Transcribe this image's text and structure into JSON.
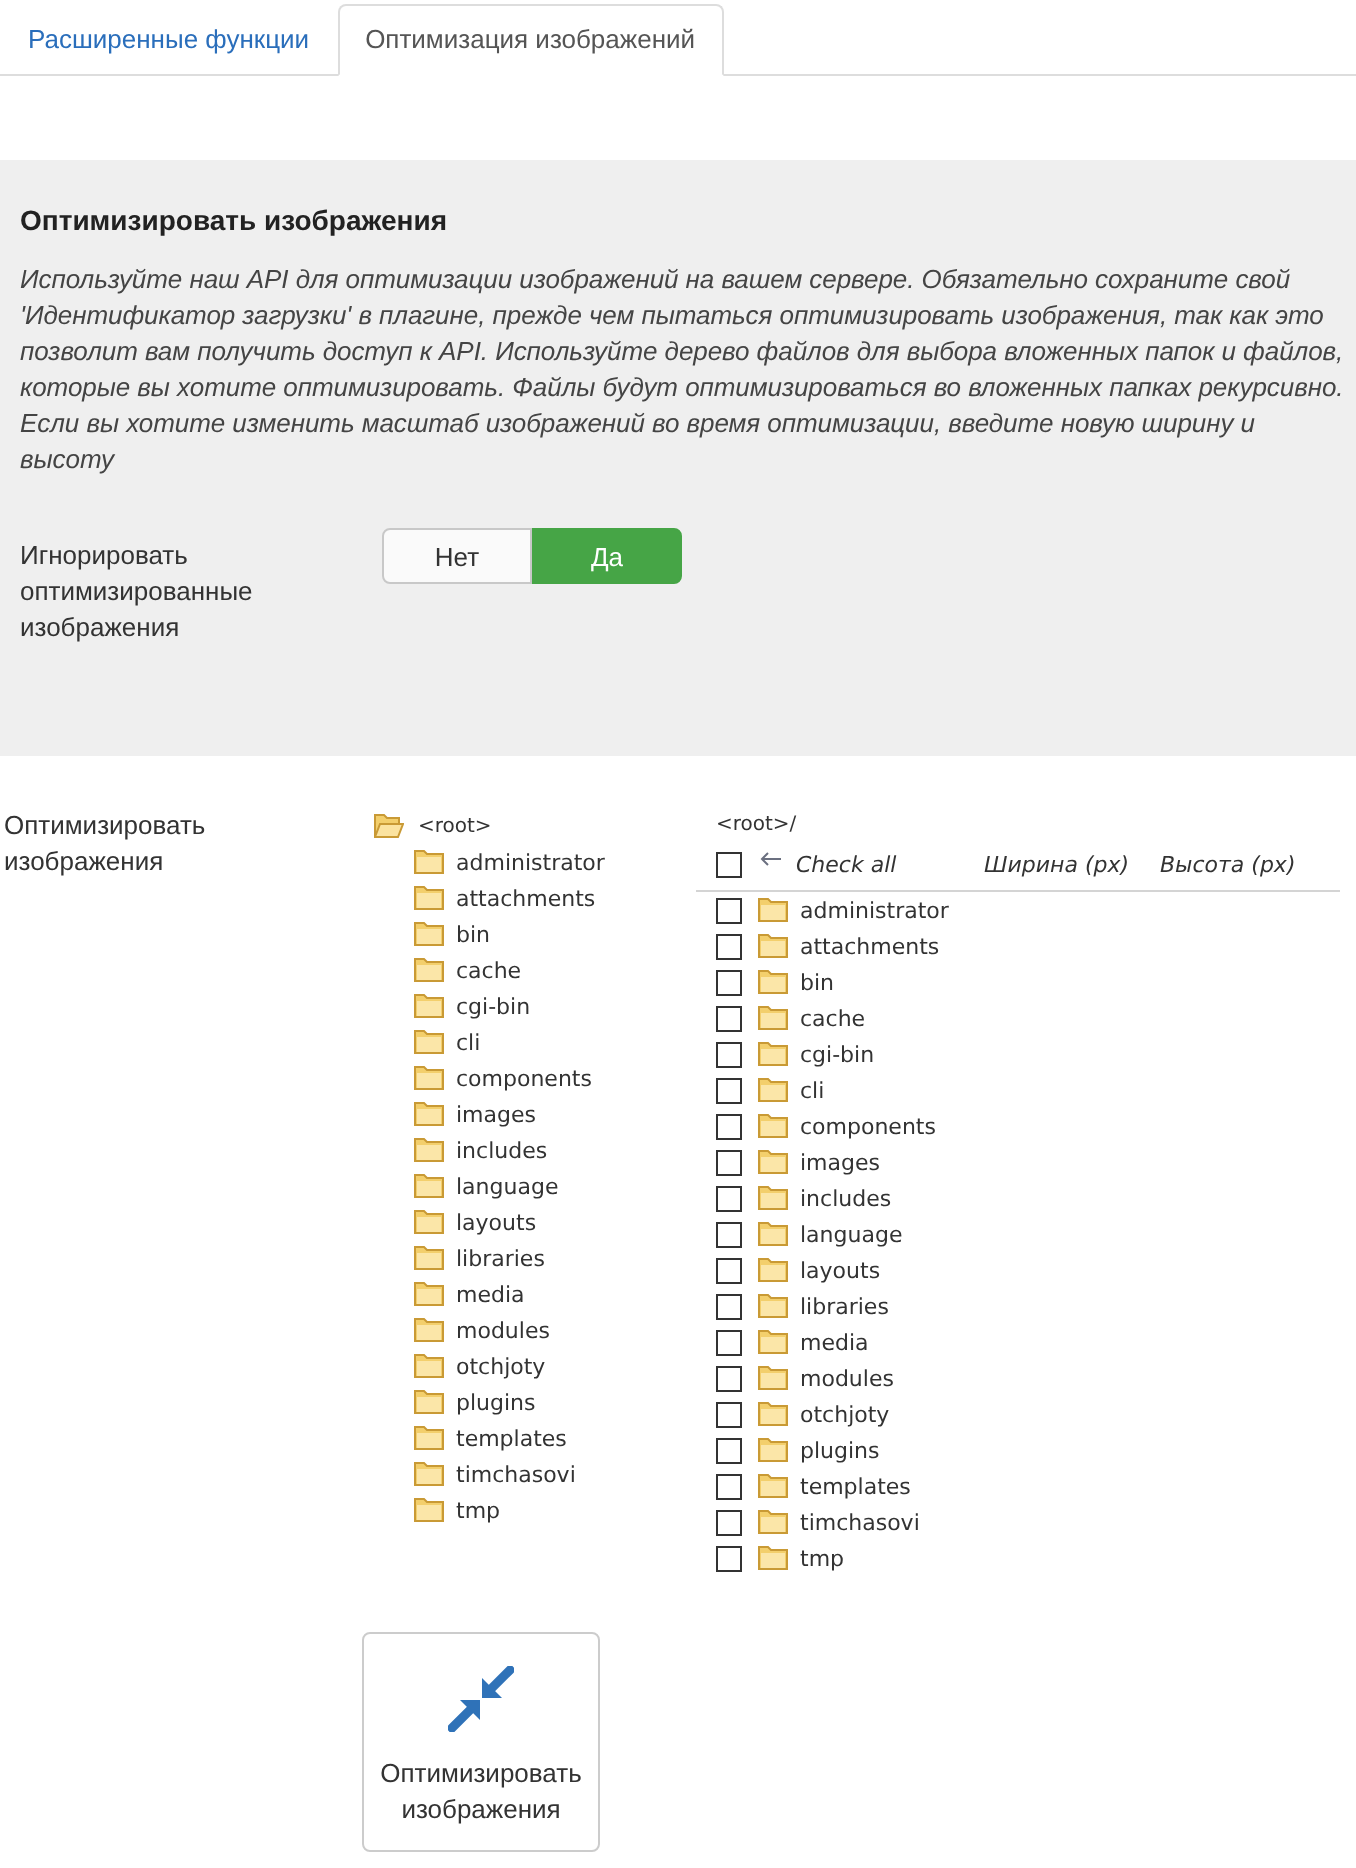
{
  "tabs": [
    {
      "label": "Расширенные функции",
      "selected": false
    },
    {
      "label": "Оптимизация изображений",
      "selected": true
    }
  ],
  "panel": {
    "title": "Оптимизировать изображения",
    "description": "Используйте наш API для оптимизации изображений на вашем сервере. Обязательно сохраните свой 'Идентификатор загрузки' в плагине, прежде чем пытаться оптимизировать изображения, так как это позволит вам получить доступ к API. Используйте дерево файлов для выбора вложенных папок и файлов, которые вы хотите оптимизировать. Файлы будут оптимизироваться во вложенных папках рекурсивно. Если вы хотите изменить масштаб изображений во время оптимизации, введите новую ширину и высоту",
    "ignore_optimized": {
      "label": "Игнорировать оптимизированные изображения",
      "options": [
        {
          "label": "Нет",
          "selected": false
        },
        {
          "label": "Да",
          "selected": true
        }
      ]
    }
  },
  "optimize": {
    "label": "Оптимизировать изображения",
    "tree": {
      "name": "<root>",
      "expanded": true,
      "children": [
        {
          "name": "administrator",
          "expanded": false
        },
        {
          "name": "attachments",
          "expanded": false
        },
        {
          "name": "bin",
          "expanded": false
        },
        {
          "name": "cache",
          "expanded": false
        },
        {
          "name": "cgi-bin",
          "expanded": false
        },
        {
          "name": "cli",
          "expanded": false
        },
        {
          "name": "components",
          "expanded": false
        },
        {
          "name": "images",
          "expanded": false
        },
        {
          "name": "includes",
          "expanded": false
        },
        {
          "name": "language",
          "expanded": false
        },
        {
          "name": "layouts",
          "expanded": false
        },
        {
          "name": "libraries",
          "expanded": false
        },
        {
          "name": "media",
          "expanded": false
        },
        {
          "name": "modules",
          "expanded": false
        },
        {
          "name": "otchjoty",
          "expanded": false
        },
        {
          "name": "plugins",
          "expanded": false
        },
        {
          "name": "templates",
          "expanded": false
        },
        {
          "name": "timchasovi",
          "expanded": false
        },
        {
          "name": "tmp",
          "expanded": false
        }
      ]
    },
    "list": {
      "path": "<root>/",
      "check_all": {
        "label": "Check all",
        "checked": false
      },
      "columns": [
        "Ширина (px)",
        "Высота (px)"
      ],
      "rows": [
        {
          "name": "administrator",
          "checked": false
        },
        {
          "name": "attachments",
          "checked": false
        },
        {
          "name": "bin",
          "checked": false
        },
        {
          "name": "cache",
          "checked": false
        },
        {
          "name": "cgi-bin",
          "checked": false
        },
        {
          "name": "cli",
          "checked": false
        },
        {
          "name": "components",
          "checked": false
        },
        {
          "name": "images",
          "checked": false
        },
        {
          "name": "includes",
          "checked": false
        },
        {
          "name": "language",
          "checked": false
        },
        {
          "name": "layouts",
          "checked": false
        },
        {
          "name": "libraries",
          "checked": false
        },
        {
          "name": "media",
          "checked": false
        },
        {
          "name": "modules",
          "checked": false
        },
        {
          "name": "otchjoty",
          "checked": false
        },
        {
          "name": "plugins",
          "checked": false
        },
        {
          "name": "templates",
          "checked": false
        },
        {
          "name": "timchasovi",
          "checked": false
        },
        {
          "name": "tmp",
          "checked": false
        }
      ]
    }
  },
  "button": {
    "label": "Оптимизировать изображения"
  }
}
